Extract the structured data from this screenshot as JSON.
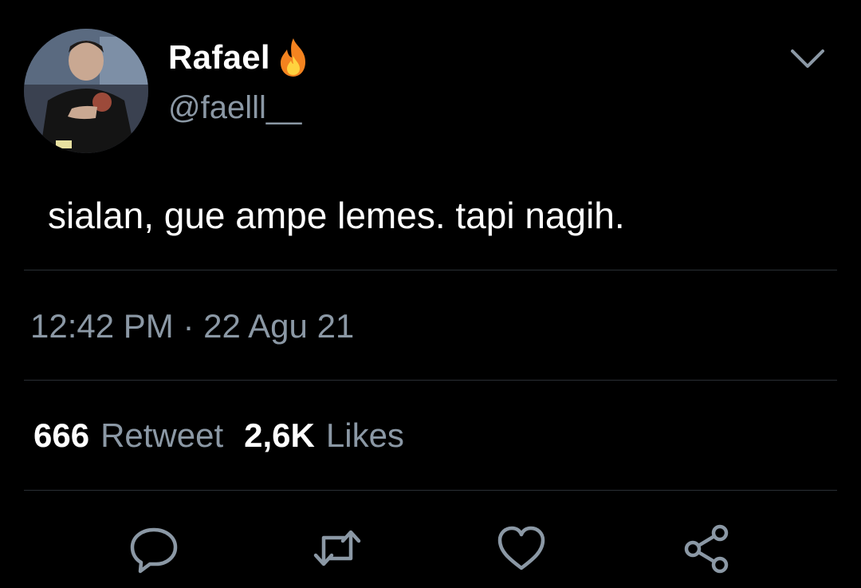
{
  "tweet": {
    "author": {
      "display_name": "Rafael",
      "name_emoji": "fire-icon",
      "handle": "@faelll__",
      "avatar": "avatar-photo"
    },
    "text": "sialan, gue ampe lemes. tapi nagih.",
    "timestamp": "12:42 PM · 22 Agu 21",
    "stats": {
      "retweets_count": "666",
      "retweets_label": "Retweet",
      "likes_count": "2,6K",
      "likes_label": "Likes"
    },
    "actions": [
      "reply-icon",
      "retweet-icon",
      "like-icon",
      "share-icon"
    ],
    "menu_icon": "chevron-down-icon"
  },
  "colors": {
    "background": "#000000",
    "text_primary": "#ffffff",
    "text_secondary": "#8b98a5",
    "divider": "#2a2f35",
    "fire_outer": "#f4831f",
    "fire_inner": "#ffd23f"
  }
}
